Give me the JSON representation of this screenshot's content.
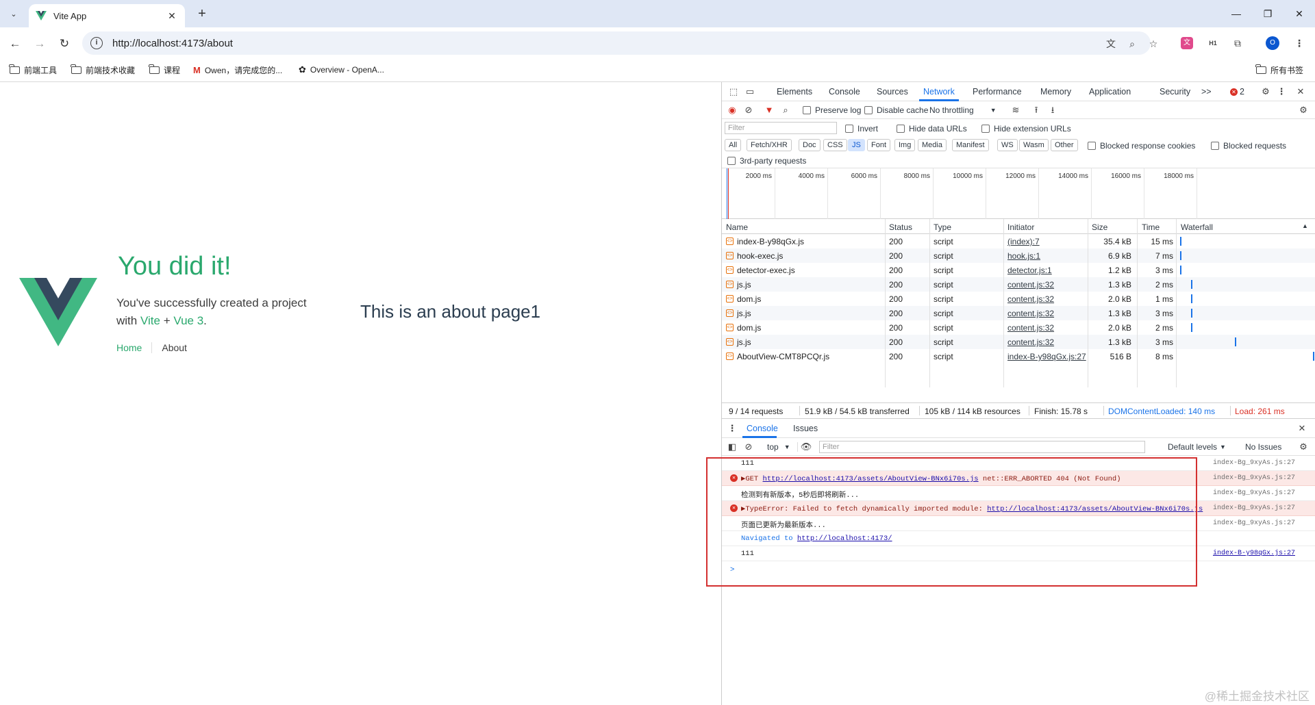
{
  "browser": {
    "tab_title": "Vite App",
    "url": "http://localhost:4173/about",
    "bookmarks": [
      {
        "label": "前端工具"
      },
      {
        "label": "前端技术收藏"
      },
      {
        "label": "课程"
      },
      {
        "label": "Owen，请完成您的..."
      },
      {
        "label": "Overview - OpenA..."
      }
    ],
    "all_bookmarks_label": "所有书签",
    "avatar_letter": "O"
  },
  "page": {
    "hero_title": "You did it!",
    "hero_text_line1": "You've successfully created a project",
    "hero_with": "with",
    "hero_vite": "Vite",
    "hero_plus": "+",
    "hero_vue": "Vue 3",
    "hero_dot": ".",
    "nav_home": "Home",
    "nav_about": "About",
    "about_text": "This is an about page1",
    "colors": {
      "accent": "#2aa86d",
      "logo_dark": "#35495e",
      "logo_green": "#41b883"
    }
  },
  "devtools": {
    "tabs": [
      "Elements",
      "Console",
      "Sources",
      "Network",
      "Performance",
      "Memory",
      "Application",
      "Security"
    ],
    "active_tab": "Network",
    "more_tabs": ">>",
    "error_count": "2",
    "toolbar": {
      "preserve_log": "Preserve log",
      "disable_cache": "Disable cache",
      "throttling": "No throttling"
    },
    "filter": {
      "placeholder": "Filter",
      "invert": "Invert",
      "hide_data_urls": "Hide data URLs",
      "hide_extension_urls": "Hide extension URLs"
    },
    "type_filters": [
      "All",
      "Fetch/XHR",
      "Doc",
      "CSS",
      "JS",
      "Font",
      "Img",
      "Media",
      "Manifest",
      "WS",
      "Wasm",
      "Other"
    ],
    "selected_type": "JS",
    "blocked_response_cookies": "Blocked response cookies",
    "blocked_requests": "Blocked requests",
    "third_party": "3rd-party requests",
    "overview_ticks": [
      "2000 ms",
      "4000 ms",
      "6000 ms",
      "8000 ms",
      "10000 ms",
      "12000 ms",
      "14000 ms",
      "16000 ms",
      "18000 ms"
    ],
    "columns": {
      "name": "Name",
      "status": "Status",
      "type": "Type",
      "initiator": "Initiator",
      "size": "Size",
      "time": "Time",
      "waterfall": "Waterfall"
    },
    "requests": [
      {
        "name": "index-B-y98qGx.js",
        "status": "200",
        "type": "script",
        "initiator": "(index):7",
        "size": "35.4 kB",
        "time": "15 ms",
        "wf": 0.01
      },
      {
        "name": "hook-exec.js",
        "status": "200",
        "type": "script",
        "initiator": "hook.js:1",
        "size": "6.9 kB",
        "time": "7 ms",
        "wf": 0.01
      },
      {
        "name": "detector-exec.js",
        "status": "200",
        "type": "script",
        "initiator": "detector.js:1",
        "size": "1.2 kB",
        "time": "3 ms",
        "wf": 0.01
      },
      {
        "name": "js.js",
        "status": "200",
        "type": "script",
        "initiator": "content.js:32",
        "size": "1.3 kB",
        "time": "2 ms",
        "wf": 0.09
      },
      {
        "name": "dom.js",
        "status": "200",
        "type": "script",
        "initiator": "content.js:32",
        "size": "2.0 kB",
        "time": "1 ms",
        "wf": 0.09
      },
      {
        "name": "js.js",
        "status": "200",
        "type": "script",
        "initiator": "content.js:32",
        "size": "1.3 kB",
        "time": "3 ms",
        "wf": 0.09
      },
      {
        "name": "dom.js",
        "status": "200",
        "type": "script",
        "initiator": "content.js:32",
        "size": "2.0 kB",
        "time": "2 ms",
        "wf": 0.09
      },
      {
        "name": "js.js",
        "status": "200",
        "type": "script",
        "initiator": "content.js:32",
        "size": "1.3 kB",
        "time": "3 ms",
        "wf": 0.42
      },
      {
        "name": "AboutView-CMT8PCQr.js",
        "status": "200",
        "type": "script",
        "initiator": "index-B-y98qGx.js:27",
        "size": "516 B",
        "time": "8 ms",
        "wf": 1.0
      }
    ],
    "summary": {
      "requests": "9 / 14 requests",
      "transferred": "51.9 kB / 54.5 kB transferred",
      "resources": "105 kB / 114 kB resources",
      "finish": "Finish: 15.78 s",
      "dcl": "DOMContentLoaded: 140 ms",
      "load": "Load: 261 ms"
    },
    "drawer_tabs": [
      "Console",
      "Issues"
    ],
    "console_toolbar": {
      "context": "top",
      "filter_placeholder": "Filter",
      "levels": "Default levels",
      "issues": "No Issues"
    },
    "console": [
      {
        "kind": "log",
        "text": "111",
        "source": "index-Bg_9xyAs.js:27"
      },
      {
        "kind": "error",
        "prefix": "▶GET ",
        "link": "http://localhost:4173/assets/AboutView-BNx6i70s.js",
        "suffix": " net::ERR_ABORTED 404 (Not Found)",
        "source": "index-Bg_9xyAs.js:27"
      },
      {
        "kind": "log",
        "text": "检测到有新版本，5秒后即将刷新...",
        "source": "index-Bg_9xyAs.js:27"
      },
      {
        "kind": "error",
        "prefix": "▶TypeError: Failed to fetch dynamically imported module: ",
        "link": "http://localhost:4173/assets/AboutView-BNx6i70s.js",
        "suffix": "",
        "source": "index-Bg_9xyAs.js:27"
      },
      {
        "kind": "log",
        "text": "页面已更新为最新版本...",
        "source": "index-Bg_9xyAs.js:27"
      },
      {
        "kind": "nav",
        "prefix": "Navigated to ",
        "link": "http://localhost:4173/",
        "suffix": "",
        "source": ""
      },
      {
        "kind": "log",
        "text": "111",
        "source": "index-B-y98qGx.js:27"
      }
    ],
    "prompt": ">"
  },
  "watermark": "@稀土掘金技术社区"
}
